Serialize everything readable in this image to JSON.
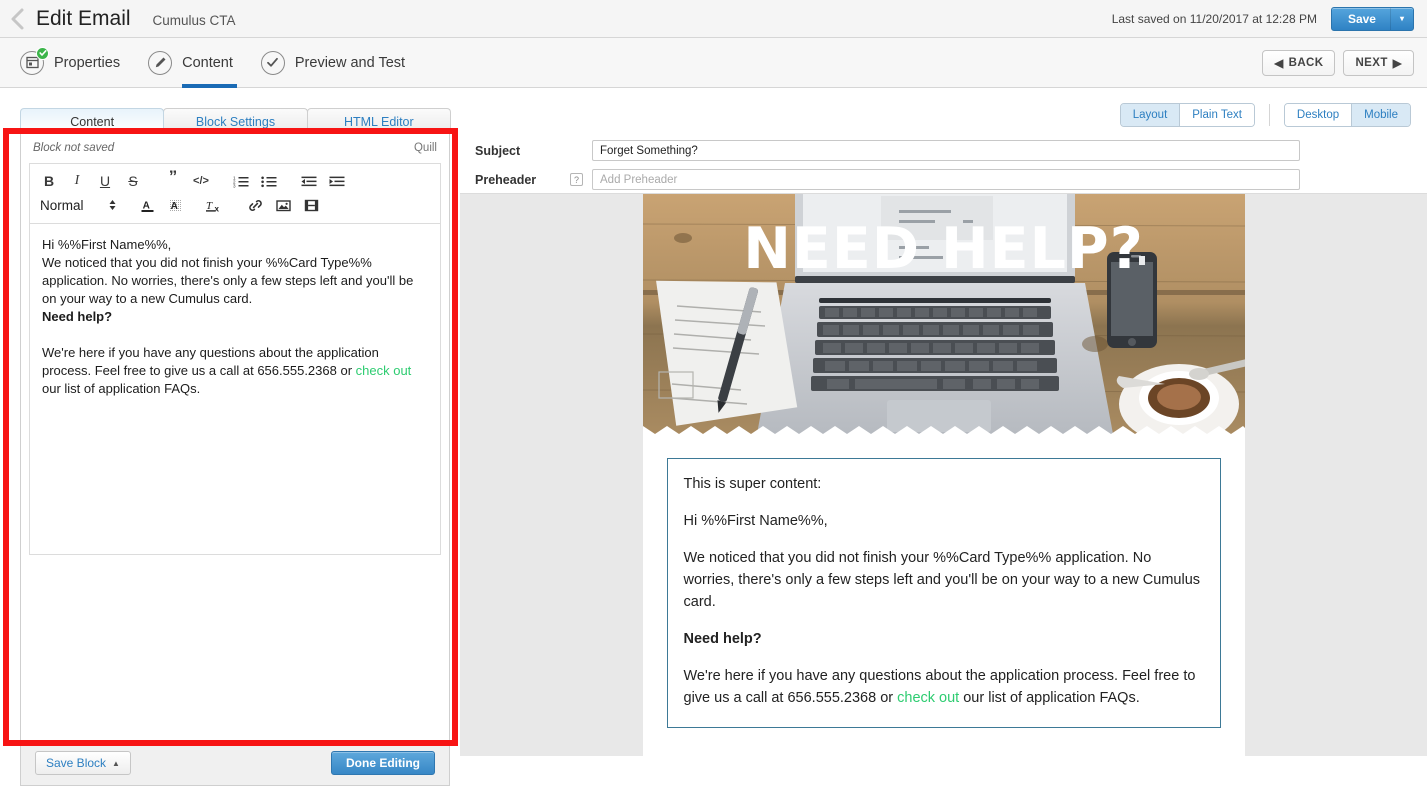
{
  "header": {
    "back_icon": "chevron-left-icon",
    "title": "Edit Email",
    "doc_name": "Cumulus CTA",
    "last_saved": "Last saved on 11/20/2017 at 12:28 PM",
    "save_label": "Save",
    "save_caret": "▾"
  },
  "steps": [
    {
      "label": "Properties",
      "icon": "properties-icon",
      "complete": true
    },
    {
      "label": "Content",
      "icon": "pencil-icon",
      "complete": false
    },
    {
      "label": "Preview and Test",
      "icon": "check-icon",
      "complete": false
    }
  ],
  "step_nav": {
    "back_label": "BACK",
    "back_icon": "◀",
    "next_label": "NEXT",
    "next_icon": "▶"
  },
  "left_panel": {
    "tabs": [
      {
        "label": "Content",
        "active": true
      },
      {
        "label": "Block Settings",
        "active": false
      },
      {
        "label": "HTML Editor",
        "active": false
      }
    ],
    "block_status": "Block not saved",
    "editor_engine": "Quill",
    "toolbar": {
      "bold": "B",
      "italic": "I",
      "underline": "U",
      "strike": "S",
      "blockquote": "”",
      "code": "</>",
      "ordered_list": "ordered-list-icon",
      "bullet_list": "bullet-list-icon",
      "outdent": "outdent-icon",
      "indent": "indent-icon",
      "format_value": "Normal",
      "format_arrows": "▴▾",
      "text_color": "A",
      "background_color": "A",
      "clear_format": "Tx",
      "link": "link-icon",
      "image": "image-icon",
      "video": "video-icon"
    },
    "body": {
      "greeting": "Hi %%First Name%%,",
      "para1": "We noticed that you did not finish your %%Card Type%% application. No worries, there's only a few steps left and you'll be on your way to a new Cumulus card.",
      "need_help": "Need help?",
      "para2_a": "We're here if you have any questions about the application process. Feel free to give us a call at 656.555.2368 or ",
      "para2_link": "check out",
      "para2_b": " our list of application FAQs."
    },
    "footer": {
      "save_block_label": "Save Block",
      "save_block_caret": "▲",
      "done_label": "Done Editing"
    }
  },
  "right_panel": {
    "view_toggles": {
      "layout": "Layout",
      "plain_text": "Plain Text",
      "desktop": "Desktop",
      "mobile": "Mobile"
    },
    "fields": {
      "subject_label": "Subject",
      "subject_value": "Forget Something?",
      "preheader_label": "Preheader",
      "preheader_help": "?",
      "preheader_placeholder": "Add Preheader"
    },
    "preview": {
      "hero_title": "NEED HELP?",
      "hero_alt": "desk-with-laptop-phone-coffee-photo",
      "content": {
        "intro": "This is super content:",
        "greeting": "Hi %%First Name%%,",
        "para1": "We noticed that you did not finish your %%Card Type%% application. No worries, there's only a few steps left and you'll be on your way to a new Cumulus card.",
        "need_help": "Need help?",
        "para2_a": "We're here if you have any questions about the application process. Feel free to give us a call at 656.555.2368 or ",
        "para2_link": "check out",
        "para2_b": " our list of application FAQs."
      }
    }
  },
  "colors": {
    "accent_blue": "#2f82c4",
    "active_tab_underline": "#1a6bb5",
    "link_green": "#2ecc71",
    "annotation_red": "#f71414",
    "complete_green": "#3cb54a",
    "content_box_border": "#3d7996"
  }
}
